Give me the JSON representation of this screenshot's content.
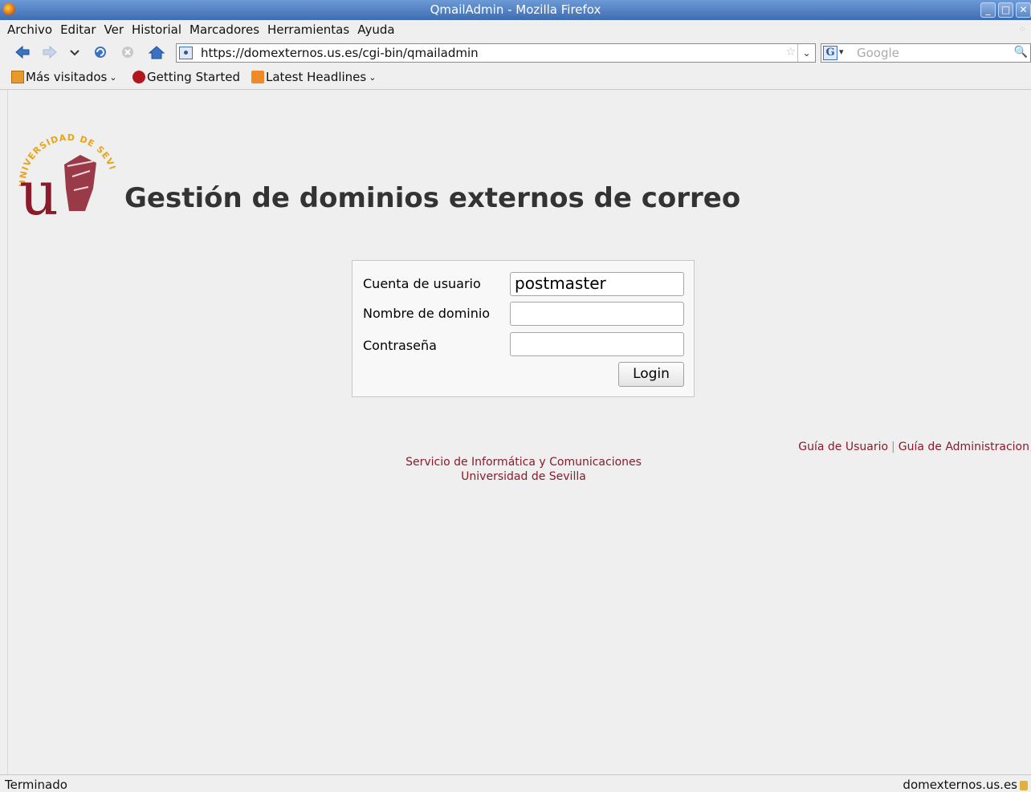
{
  "window": {
    "title": "QmailAdmin - Mozilla Firefox",
    "buttons": [
      "_",
      "□",
      "✕"
    ]
  },
  "menu": {
    "items": [
      "Archivo",
      "Editar",
      "Ver",
      "Historial",
      "Marcadores",
      "Herramientas",
      "Ayuda"
    ]
  },
  "nav": {
    "url": "https://domexternos.us.es/cgi-bin/qmailadmin",
    "search_placeholder": "Google"
  },
  "bookmarks": {
    "items": [
      "Más visitados",
      "Getting Started",
      "Latest Headlines"
    ]
  },
  "page": {
    "logo_alt": "UNIVERSIDAD DE SEVILLA",
    "title": "Gestión de dominios externos de correo",
    "login": {
      "user_label": "Cuenta de usuario",
      "user_value": "postmaster",
      "domain_label": "Nombre de dominio",
      "domain_value": "",
      "password_label": "Contraseña",
      "password_value": "",
      "submit_label": "Login"
    },
    "links": {
      "user_guide": "Guía de Usuario",
      "separator": "|",
      "admin_guide": "Guía de Administracion"
    },
    "footer": {
      "line1": "Servicio de Informática y Comunicaciones",
      "line2": "Universidad de Sevilla"
    }
  },
  "status": {
    "left": "Terminado",
    "right": "domexternos.us.es"
  },
  "colors": {
    "link": "#8b1a2b",
    "title_bar": "#4b78bf",
    "logo": "#8b1a2b",
    "logo_text": "#e8a51a"
  }
}
